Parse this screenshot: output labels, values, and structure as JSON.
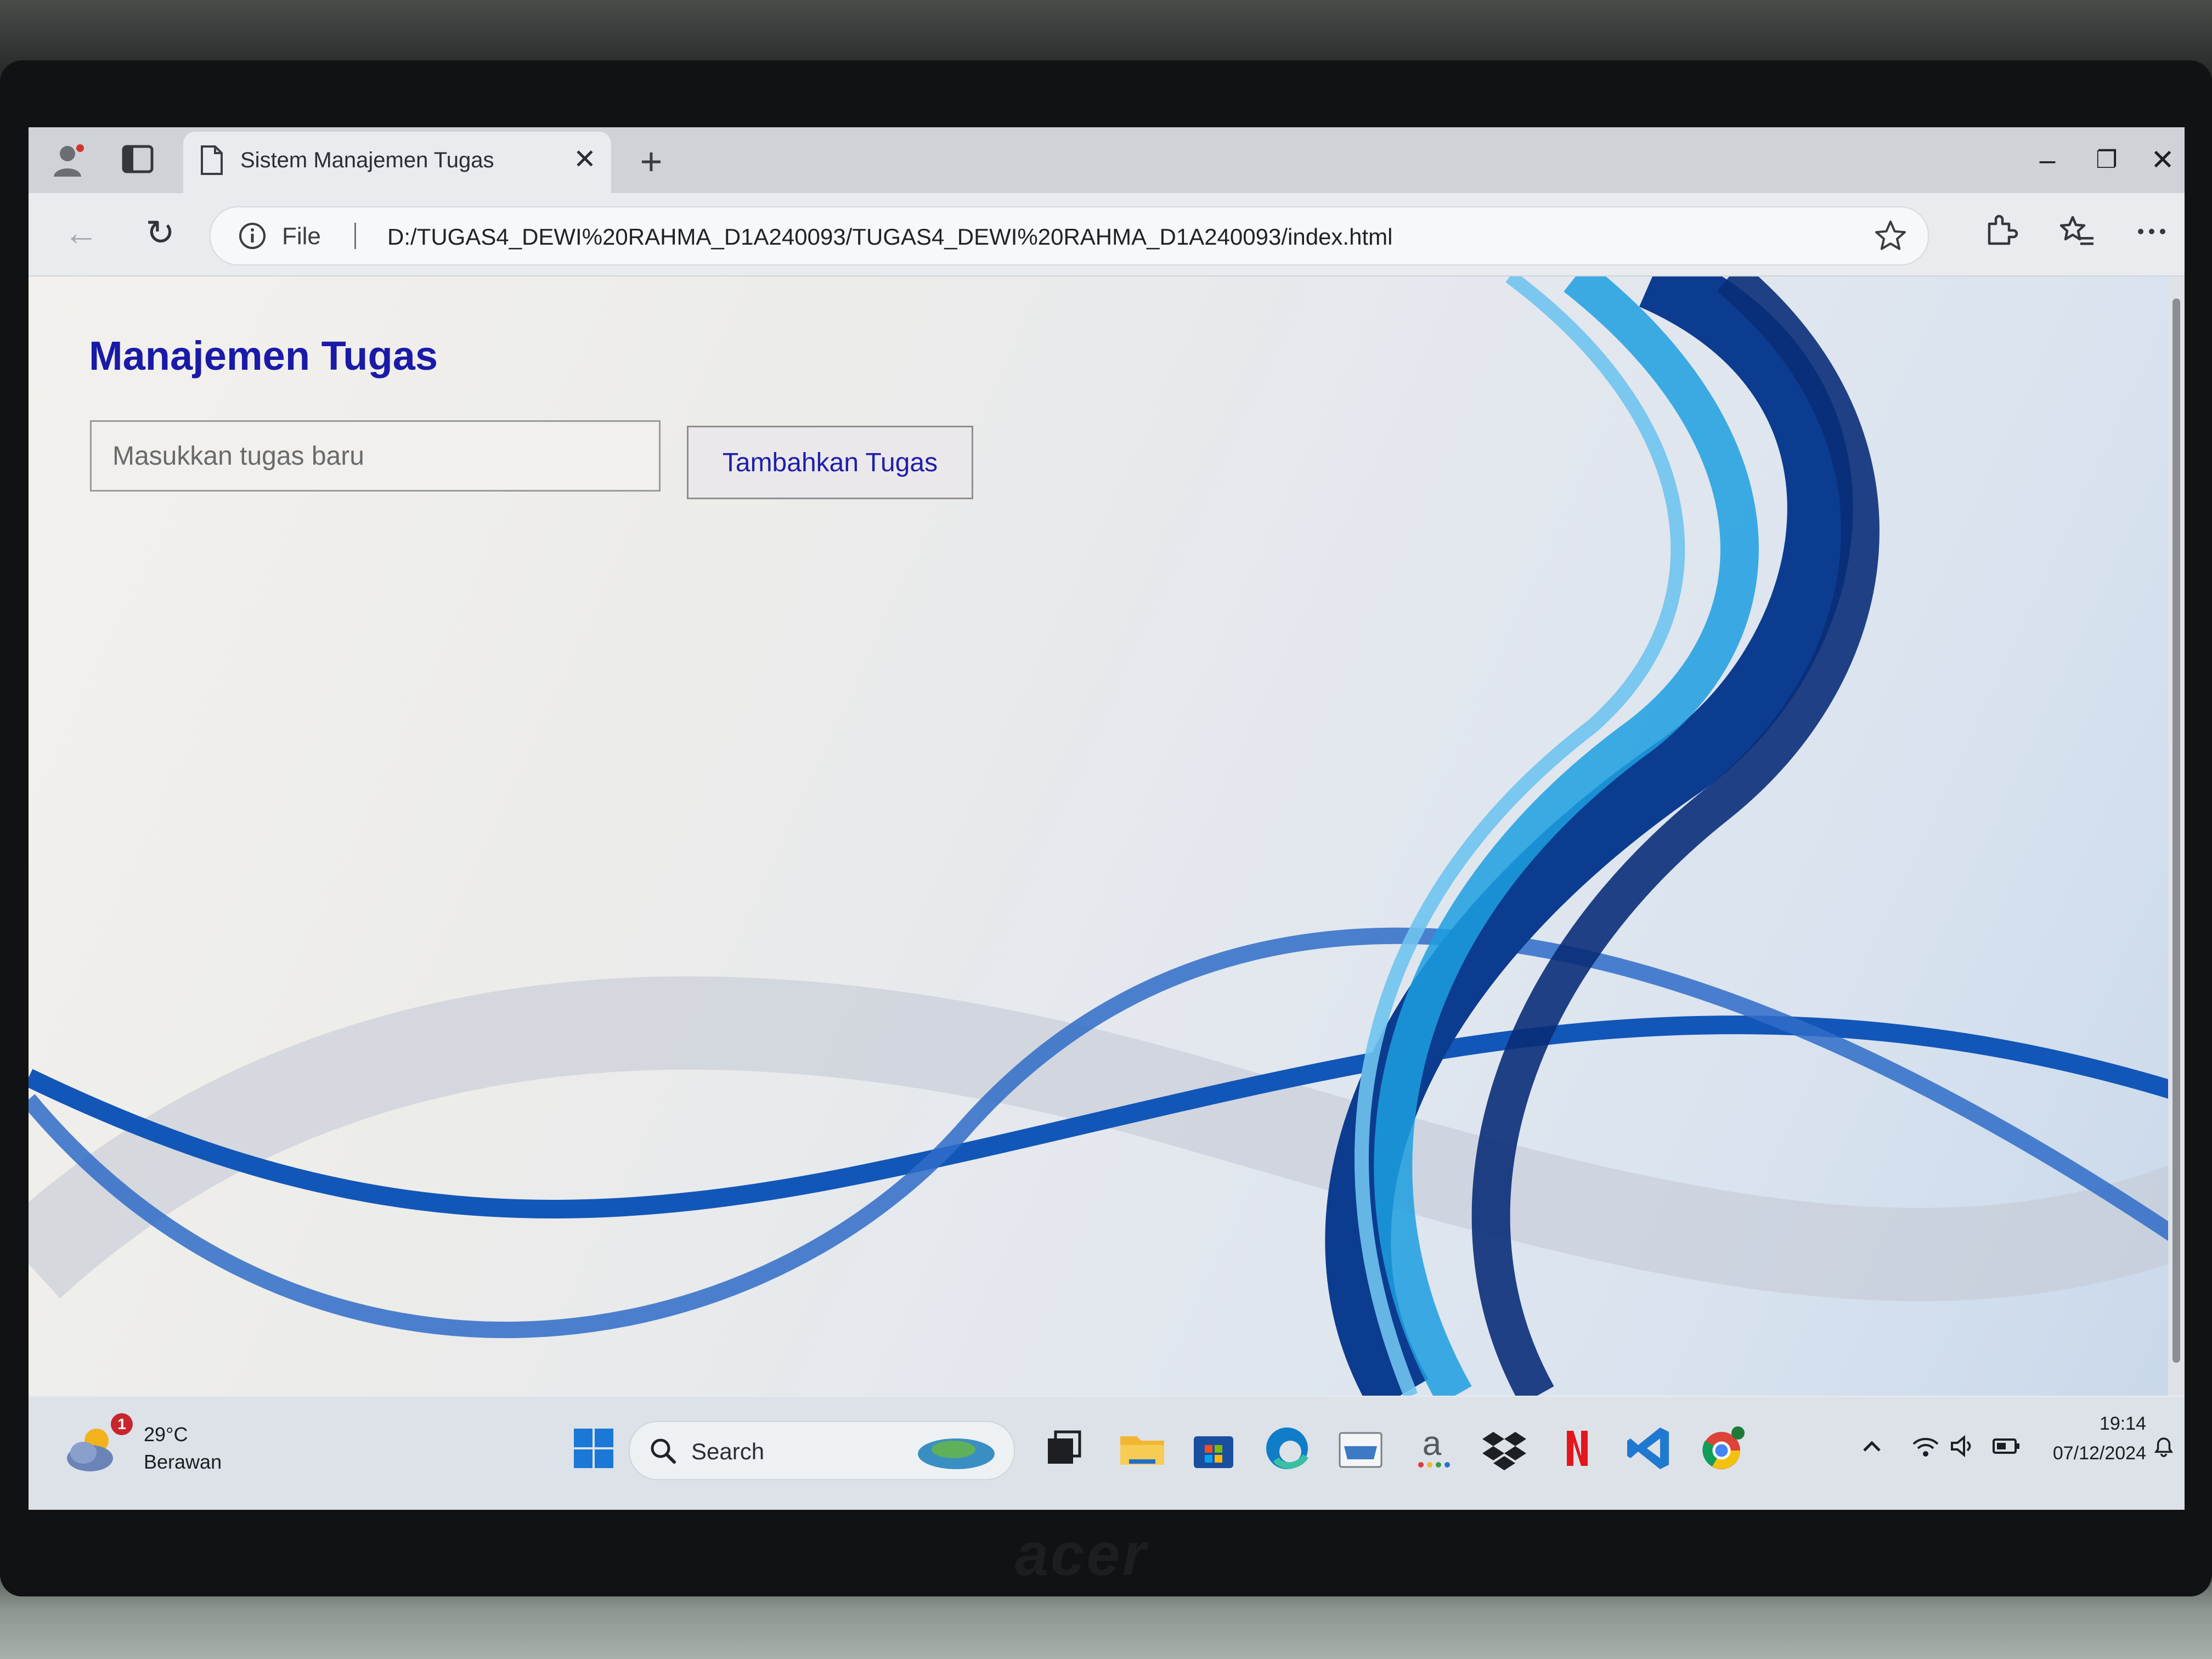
{
  "browser": {
    "tab_title": "Sistem Manajemen Tugas",
    "tab_close": "✕",
    "new_tab": "+",
    "address": {
      "scheme_label": "File",
      "url": "D:/TUGAS4_DEWI%20RAHMA_D1A240093/TUGAS4_DEWI%20RAHMA_D1A240093/index.html"
    },
    "window_controls": {
      "minimize": "–",
      "restore": "❐",
      "close": "✕"
    },
    "nav": {
      "back": "←",
      "reload": "↻"
    }
  },
  "page": {
    "title": "Manajemen Tugas",
    "task_input_placeholder": "Masukkan tugas baru",
    "task_input_value": "",
    "add_button_label": "Tambahkan Tugas"
  },
  "taskbar": {
    "weather": {
      "badge": "1",
      "temperature": "29°C",
      "condition": "Berawan"
    },
    "search_label": "Search",
    "clock": {
      "time": "19:14",
      "date": "07/12/2024"
    }
  },
  "device": {
    "brand": "acer"
  },
  "colors": {
    "title": "#1a1aa8",
    "button_text": "#1f1fa8",
    "accent_blue": "#0b49b8"
  }
}
